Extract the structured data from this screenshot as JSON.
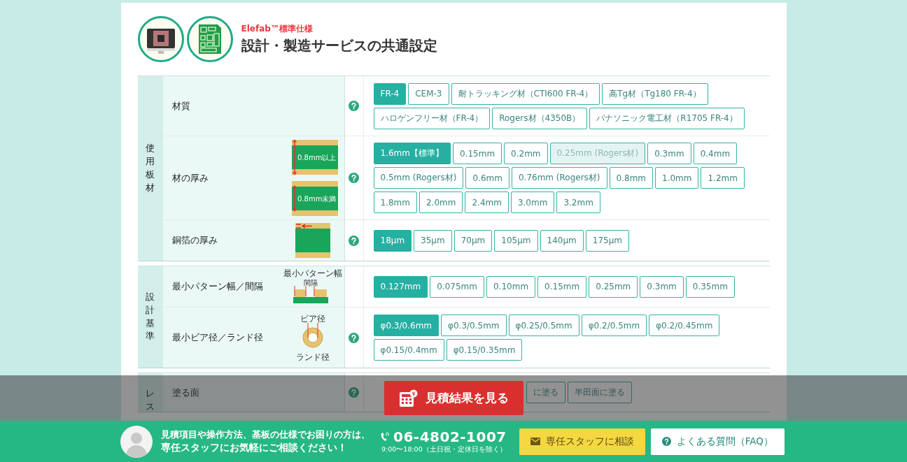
{
  "header": {
    "brand": "Elefab™標準仕様",
    "title": "設計・製造サービスの共通設定"
  },
  "groups": [
    {
      "label": "使用板材",
      "covered": false,
      "rows": [
        {
          "label": "材質",
          "kind": "plain",
          "help": true,
          "options": [
            {
              "label": "FR-4",
              "selected": true,
              "disabled": false
            },
            {
              "label": "CEM-3",
              "selected": false,
              "disabled": false
            },
            {
              "label": "耐トラッキング材（CTI600 FR-4）",
              "selected": false,
              "disabled": false
            },
            {
              "label": "高Tg材（Tg180 FR-4）",
              "selected": false,
              "disabled": false
            },
            {
              "label": "ハロゲンフリー材（FR-4）",
              "selected": false,
              "disabled": false
            },
            {
              "label": "Rogers材（4350B）",
              "selected": false,
              "disabled": false
            },
            {
              "label": "パナソニック電工材（R1705 FR-4）",
              "selected": false,
              "disabled": false
            }
          ]
        },
        {
          "label": "材の厚み",
          "kind": "thickness",
          "captions": [
            "0.8mm以上",
            "0.8mm未満"
          ],
          "help": true,
          "options": [
            {
              "label": "1.6mm【標準】",
              "selected": true,
              "disabled": false
            },
            {
              "label": "0.15mm",
              "selected": false,
              "disabled": false
            },
            {
              "label": "0.2mm",
              "selected": false,
              "disabled": false
            },
            {
              "label": "0.25mm (Rogers材)",
              "selected": false,
              "disabled": true
            },
            {
              "label": "0.3mm",
              "selected": false,
              "disabled": false
            },
            {
              "label": "0.4mm",
              "selected": false,
              "disabled": false
            },
            {
              "label": "0.5mm (Rogers材)",
              "selected": false,
              "disabled": false
            },
            {
              "label": "0.6mm",
              "selected": false,
              "disabled": false
            },
            {
              "label": "0.76mm (Rogers材)",
              "selected": false,
              "disabled": false
            },
            {
              "label": "0.8mm",
              "selected": false,
              "disabled": false
            },
            {
              "label": "1.0mm",
              "selected": false,
              "disabled": false
            },
            {
              "label": "1.2mm",
              "selected": false,
              "disabled": false
            },
            {
              "label": "1.8mm",
              "selected": false,
              "disabled": false
            },
            {
              "label": "2.0mm",
              "selected": false,
              "disabled": false
            },
            {
              "label": "2.4mm",
              "selected": false,
              "disabled": false
            },
            {
              "label": "3.0mm",
              "selected": false,
              "disabled": false
            },
            {
              "label": "3.2mm",
              "selected": false,
              "disabled": false
            }
          ]
        },
        {
          "label": "銅箔の厚み",
          "kind": "copper",
          "help": true,
          "options": [
            {
              "label": "18μm",
              "selected": true,
              "disabled": false
            },
            {
              "label": "35μm",
              "selected": false,
              "disabled": false
            },
            {
              "label": "70μm",
              "selected": false,
              "disabled": false
            },
            {
              "label": "105μm",
              "selected": false,
              "disabled": false
            },
            {
              "label": "140μm",
              "selected": false,
              "disabled": false
            },
            {
              "label": "175μm",
              "selected": false,
              "disabled": false
            }
          ]
        }
      ]
    },
    {
      "label": "設計基準",
      "covered": false,
      "rows": [
        {
          "label": "最小パターン幅／間隔",
          "kind": "pattern",
          "captions": [
            "最小パターン幅",
            "間隔"
          ],
          "help": false,
          "options": [
            {
              "label": "0.127mm",
              "selected": true,
              "disabled": false
            },
            {
              "label": "0.075mm",
              "selected": false,
              "disabled": false
            },
            {
              "label": "0.10mm",
              "selected": false,
              "disabled": false
            },
            {
              "label": "0.15mm",
              "selected": false,
              "disabled": false
            },
            {
              "label": "0.25mm",
              "selected": false,
              "disabled": false
            },
            {
              "label": "0.3mm",
              "selected": false,
              "disabled": false
            },
            {
              "label": "0.35mm",
              "selected": false,
              "disabled": false
            }
          ]
        },
        {
          "label": "最小ビア径／ランド径",
          "kind": "via",
          "captions": [
            "ビア径",
            "ランド径"
          ],
          "help": true,
          "options": [
            {
              "label": "φ0.3/0.6mm",
              "selected": true,
              "disabled": false
            },
            {
              "label": "φ0.3/0.5mm",
              "selected": false,
              "disabled": false
            },
            {
              "label": "φ0.25/0.5mm",
              "selected": false,
              "disabled": false
            },
            {
              "label": "φ0.2/0.5mm",
              "selected": false,
              "disabled": false
            },
            {
              "label": "φ0.2/0.45mm",
              "selected": false,
              "disabled": false
            },
            {
              "label": "φ0.15/0.4mm",
              "selected": false,
              "disabled": false
            },
            {
              "label": "φ0.15/0.35mm",
              "selected": false,
              "disabled": false
            }
          ]
        }
      ]
    },
    {
      "label": "レス",
      "covered": true,
      "rows": [
        {
          "label": "塗る面",
          "kind": "plain",
          "help": true,
          "options": [
            {
              "label": "に塗る",
              "selected": false
            },
            {
              "label": "半田面に塗る",
              "selected": false
            }
          ]
        }
      ]
    }
  ],
  "estimate_button": {
    "label": "見積結果を見る"
  },
  "footer": {
    "message_lines": [
      "見積項目や操作方法、基板の仕様でお困りの方は、",
      "専任スタッフにお気軽にご相談ください！"
    ],
    "phone": "06-4802-1007",
    "hours": "9:00〜18:00（土日祝・定休日を除く）",
    "contact_button": "専任スタッフに相談",
    "faq_button": "よくある質問（FAQ）"
  }
}
